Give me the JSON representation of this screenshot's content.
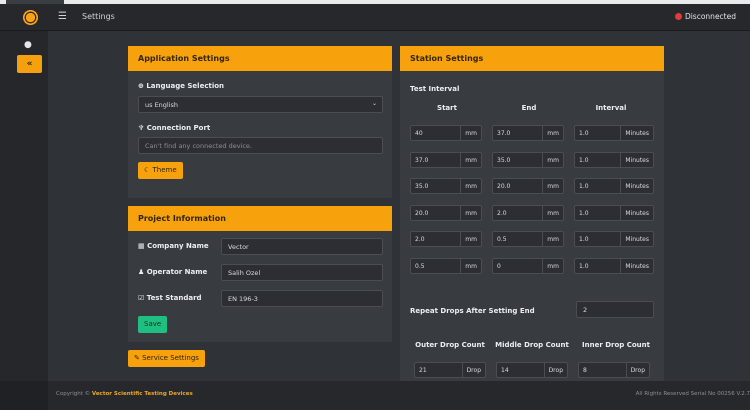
{
  "navbar": {
    "title": "Settings",
    "status": "Disconnected"
  },
  "app_settings": {
    "header": "Application Settings",
    "language_label": "Language Selection",
    "language_value": "us English",
    "port_label": "Connection Port",
    "port_placeholder": "Can't find any connected device.",
    "theme_button": "Theme"
  },
  "project": {
    "header": "Project Information",
    "company_label": "Company Name",
    "company_value": "Vector",
    "operator_label": "Operator Name",
    "operator_value": "Salih Ozel",
    "standard_label": "Test Standard",
    "standard_value": "EN 196-3",
    "save_button": "Save"
  },
  "service_button": "Service Settings",
  "station": {
    "header": "Station Settings",
    "interval_title": "Test Interval",
    "col_start": "Start",
    "col_end": "End",
    "col_interval": "Interval",
    "rows": [
      {
        "start": "40",
        "start_unit": "mm",
        "end": "37.0",
        "end_unit": "mm",
        "interval": "1.0",
        "interval_unit": "Minutes"
      },
      {
        "start": "37.0",
        "start_unit": "mm",
        "end": "35.0",
        "end_unit": "mm",
        "interval": "1.0",
        "interval_unit": "Minutes"
      },
      {
        "start": "35.0",
        "start_unit": "mm",
        "end": "20.0",
        "end_unit": "mm",
        "interval": "1.0",
        "interval_unit": "Minutes"
      },
      {
        "start": "20.0",
        "start_unit": "mm",
        "end": "2.0",
        "end_unit": "mm",
        "interval": "1.0",
        "interval_unit": "Minutes"
      },
      {
        "start": "2.0",
        "start_unit": "mm",
        "end": "0.5",
        "end_unit": "mm",
        "interval": "1.0",
        "interval_unit": "Minutes"
      },
      {
        "start": "0.5",
        "start_unit": "mm",
        "end": "0",
        "end_unit": "mm",
        "interval": "1.0",
        "interval_unit": "Minutes"
      }
    ],
    "repeat_label": "Repeat Drops After Setting End",
    "repeat_value": "2",
    "outer_label": "Outer Drop Count",
    "middle_label": "Middle Drop Count",
    "inner_label": "Inner Drop Count",
    "outer_value": "21",
    "outer_unit": "Drop",
    "middle_value": "14",
    "middle_unit": "Drop",
    "inner_value": "8",
    "inner_unit": "Drop"
  },
  "footer": {
    "copyright_prefix": "Copyright ©",
    "company": "Vector Scientific Testing Devices",
    "rights": "All Rights Reserved Serial No 00256 V.2.7"
  }
}
